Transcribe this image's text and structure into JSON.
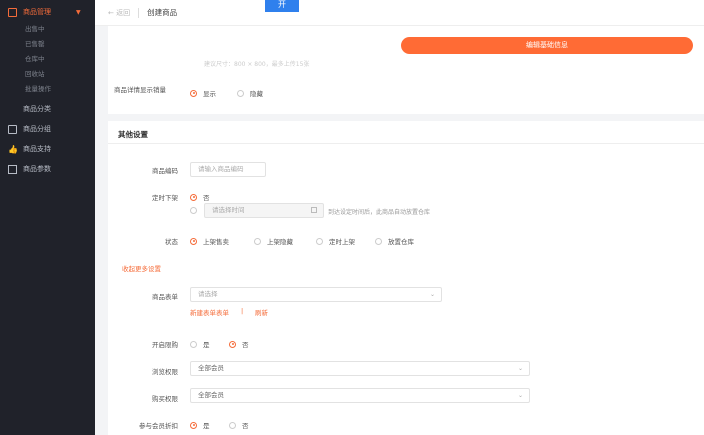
{
  "sidebar": {
    "groups": [
      {
        "label": "商品管理",
        "active": true,
        "children": [
          "出售中",
          "已售罄",
          "仓库中",
          "回收站",
          "批量操作"
        ]
      },
      {
        "label": "商品分类"
      },
      {
        "label": "商品分组"
      },
      {
        "label": "商品支持"
      },
      {
        "label": "商品参数"
      }
    ]
  },
  "header": {
    "back": "← 返回",
    "title": "创建商品",
    "floater": "开"
  },
  "card1": {
    "edit_button": "编辑基础信息",
    "faded_text": "建议尺寸：800 × 800，最多上传15张",
    "detail_label": "商品详情显示销量",
    "detail_options": [
      "显示",
      "隐藏"
    ]
  },
  "other": {
    "title": "其他设置",
    "code_label": "商品编码",
    "code_placeholder": "请输入商品编码",
    "timer_label": "定时下架",
    "timer_no": "否",
    "timer_placeholder": "请选择时间",
    "timer_hint": "到达设定时间后，此商品自动放置仓库",
    "status_label": "状态",
    "status_options": [
      "上架售卖",
      "上架隐藏",
      "定时上架",
      "放置仓库"
    ],
    "collapse_link": "收起更多设置",
    "form_label": "商品表单",
    "form_placeholder": "请选择",
    "form_new_link": "新建表单表单",
    "form_sep": "|",
    "form_refresh": "刷新",
    "limit_label": "开启限购",
    "limit_options": [
      "是",
      "否"
    ],
    "browse_label": "浏览权限",
    "browse_value": "全部会员",
    "buy_label": "购买权限",
    "buy_value": "全部会员",
    "discount_label": "参与会员折扣",
    "discount_options": [
      "是",
      "否"
    ]
  },
  "colors": {
    "accent": "#ff6b35",
    "sidebar": "#20222a",
    "floater": "#2f80ed"
  }
}
